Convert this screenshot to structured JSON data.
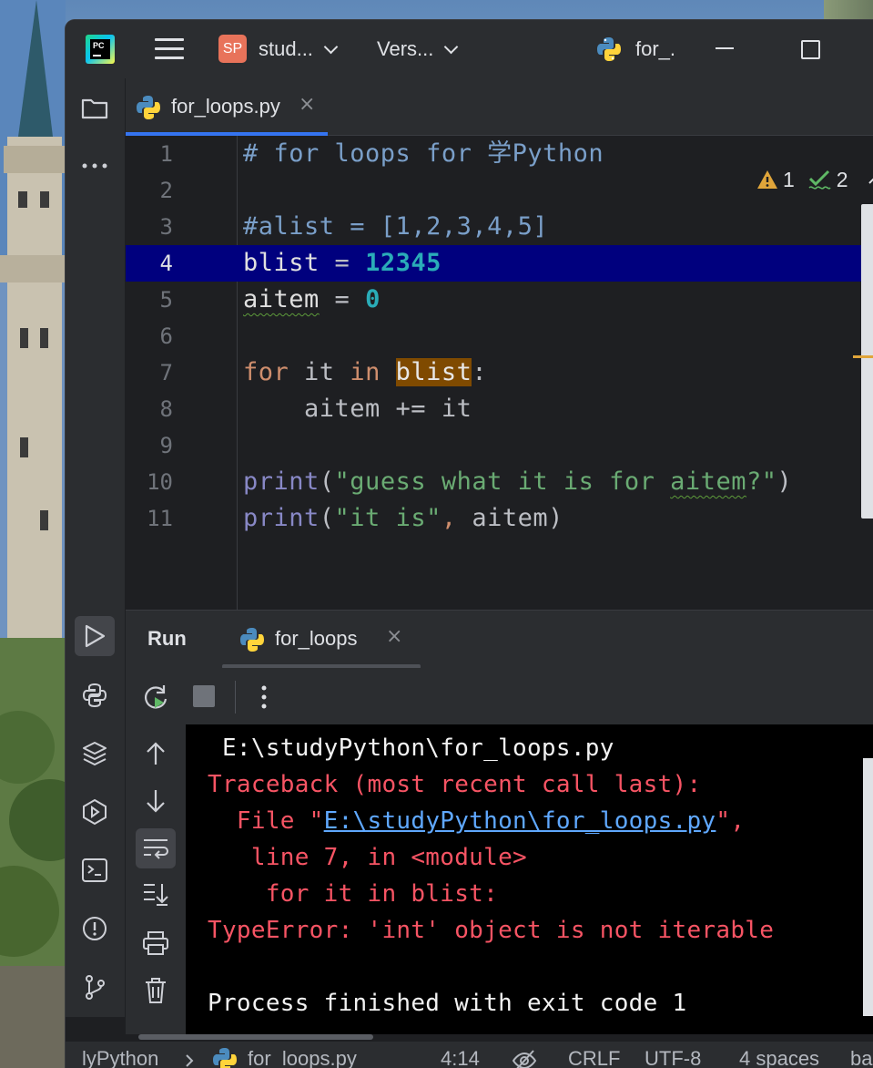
{
  "titlebar": {
    "app_logo_text": "PC",
    "project_badge": "SP",
    "project_name": "stud...",
    "vcs_label": "Vers...",
    "run_config": "for_."
  },
  "editor_tab": {
    "label": "for_loops.py",
    "close": "×"
  },
  "inspections": {
    "warnings": "1",
    "ok": "2"
  },
  "code_lines": [
    {
      "n": "1",
      "text": "# for loops for 学Python"
    },
    {
      "n": "2",
      "text": ""
    },
    {
      "n": "3",
      "text": "#alist = [1,2,3,4,5]"
    },
    {
      "n": "4",
      "text": "blist = 12345"
    },
    {
      "n": "5",
      "text": "aitem = 0"
    },
    {
      "n": "6",
      "text": ""
    },
    {
      "n": "7",
      "text": "for it in blist:"
    },
    {
      "n": "8",
      "text": "    aitem += it"
    },
    {
      "n": "9",
      "text": ""
    },
    {
      "n": "10",
      "text": "print(\"guess what it is for aitem?\")"
    },
    {
      "n": "11",
      "text": "print(\"it is\", aitem)"
    }
  ],
  "code_tokens": {
    "l1": "# for loops for 学Python",
    "l3": "#alist = [1,2,3,4,5]",
    "l4_var": "blist",
    "l4_op": " = ",
    "l4_num": "12345",
    "l5_var": "aitem",
    "l5_op": " = ",
    "l5_num": "0",
    "l7_for": "for",
    "l7_it": " it ",
    "l7_in": "in",
    "l7_sp": " ",
    "l7_blist": "blist",
    "l7_colon": ":",
    "l8": "    aitem += it",
    "l10_fn": "print",
    "l10_p1": "(",
    "l10_s1": "\"guess what it is for ",
    "l10_s2": "aitem",
    "l10_s3": "?\"",
    "l10_p2": ")",
    "l11_fn": "print",
    "l11_p1": "(",
    "l11_s": "\"it is\"",
    "l11_comma": ",",
    "l11_rest": " aitem)"
  },
  "run_panel": {
    "title": "Run",
    "tab_label": "for_loops",
    "tab_close": "×"
  },
  "console": {
    "path_line": " E:\\studyPython\\for_loops.py",
    "traceback": "Traceback (most recent call last):",
    "file_prefix": "  File \"",
    "file_link": "E:\\studyPython\\for_loops.py",
    "file_suffix": "\",",
    "line_info": "   line 7, in <module>",
    "code_echo": "    for it in blist:",
    "error": "TypeError: 'int' object is not iterable",
    "exit": "Process finished with exit code 1"
  },
  "statusbar": {
    "project": "lyPython",
    "file": "for_loops.py",
    "caret": "4:14",
    "line_sep": "CRLF",
    "encoding": "UTF-8",
    "indent": "4 spaces",
    "interpreter": "ba"
  },
  "colors": {
    "accent": "#3574f0",
    "error_red": "#f75464",
    "line_highlight": "#00007e",
    "warning": "#e0a53a"
  }
}
